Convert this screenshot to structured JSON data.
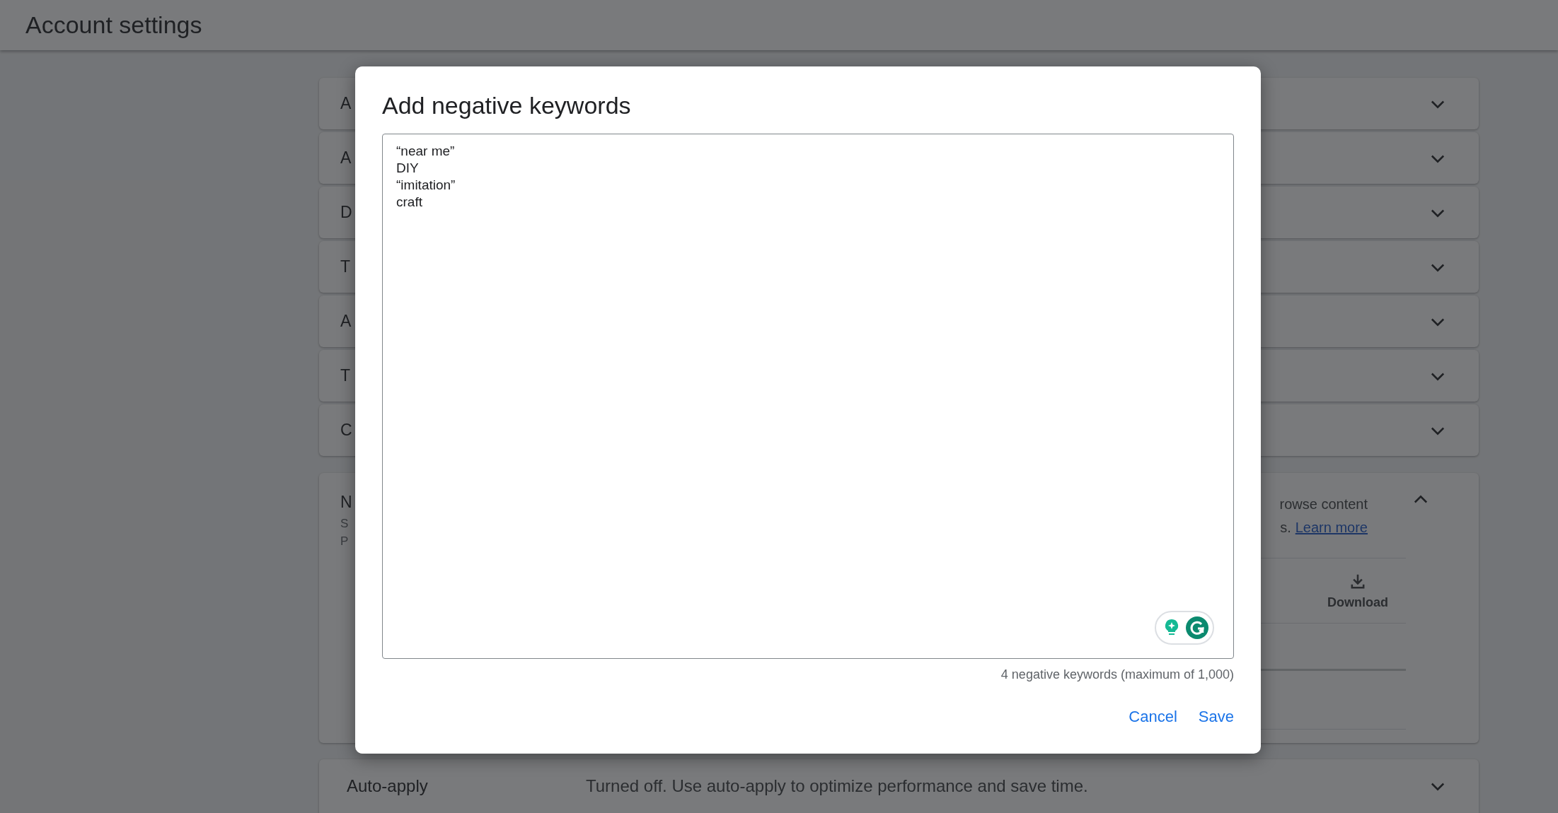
{
  "header": {
    "title": "Account settings"
  },
  "cards": [
    {
      "title": "A",
      "expanded": false
    },
    {
      "title": "A",
      "expanded": false
    },
    {
      "title": "D",
      "expanded": false
    },
    {
      "title": "T",
      "expanded": false
    },
    {
      "title": "A",
      "expanded": false
    },
    {
      "title": "T",
      "expanded": false
    },
    {
      "title": "C",
      "expanded": false
    },
    {
      "title": "N",
      "expanded": true,
      "subtitle_lines": [
        "S",
        "P"
      ],
      "description_lines": [
        "rowse content",
        "s."
      ],
      "link": "Learn more",
      "action": {
        "label": "Download"
      }
    },
    {
      "title": "Auto-apply",
      "expanded": false,
      "summary": "Turned off. Use auto-apply to optimize performance and save time."
    }
  ],
  "dialog": {
    "title": "Add negative keywords",
    "keywords_field": {
      "value": "“near me”\nDIY\n“imitation”\ncraft"
    },
    "count": "4 negative keywords (maximum of 1,000)",
    "buttons": [
      "Cancel",
      "Save"
    ]
  }
}
